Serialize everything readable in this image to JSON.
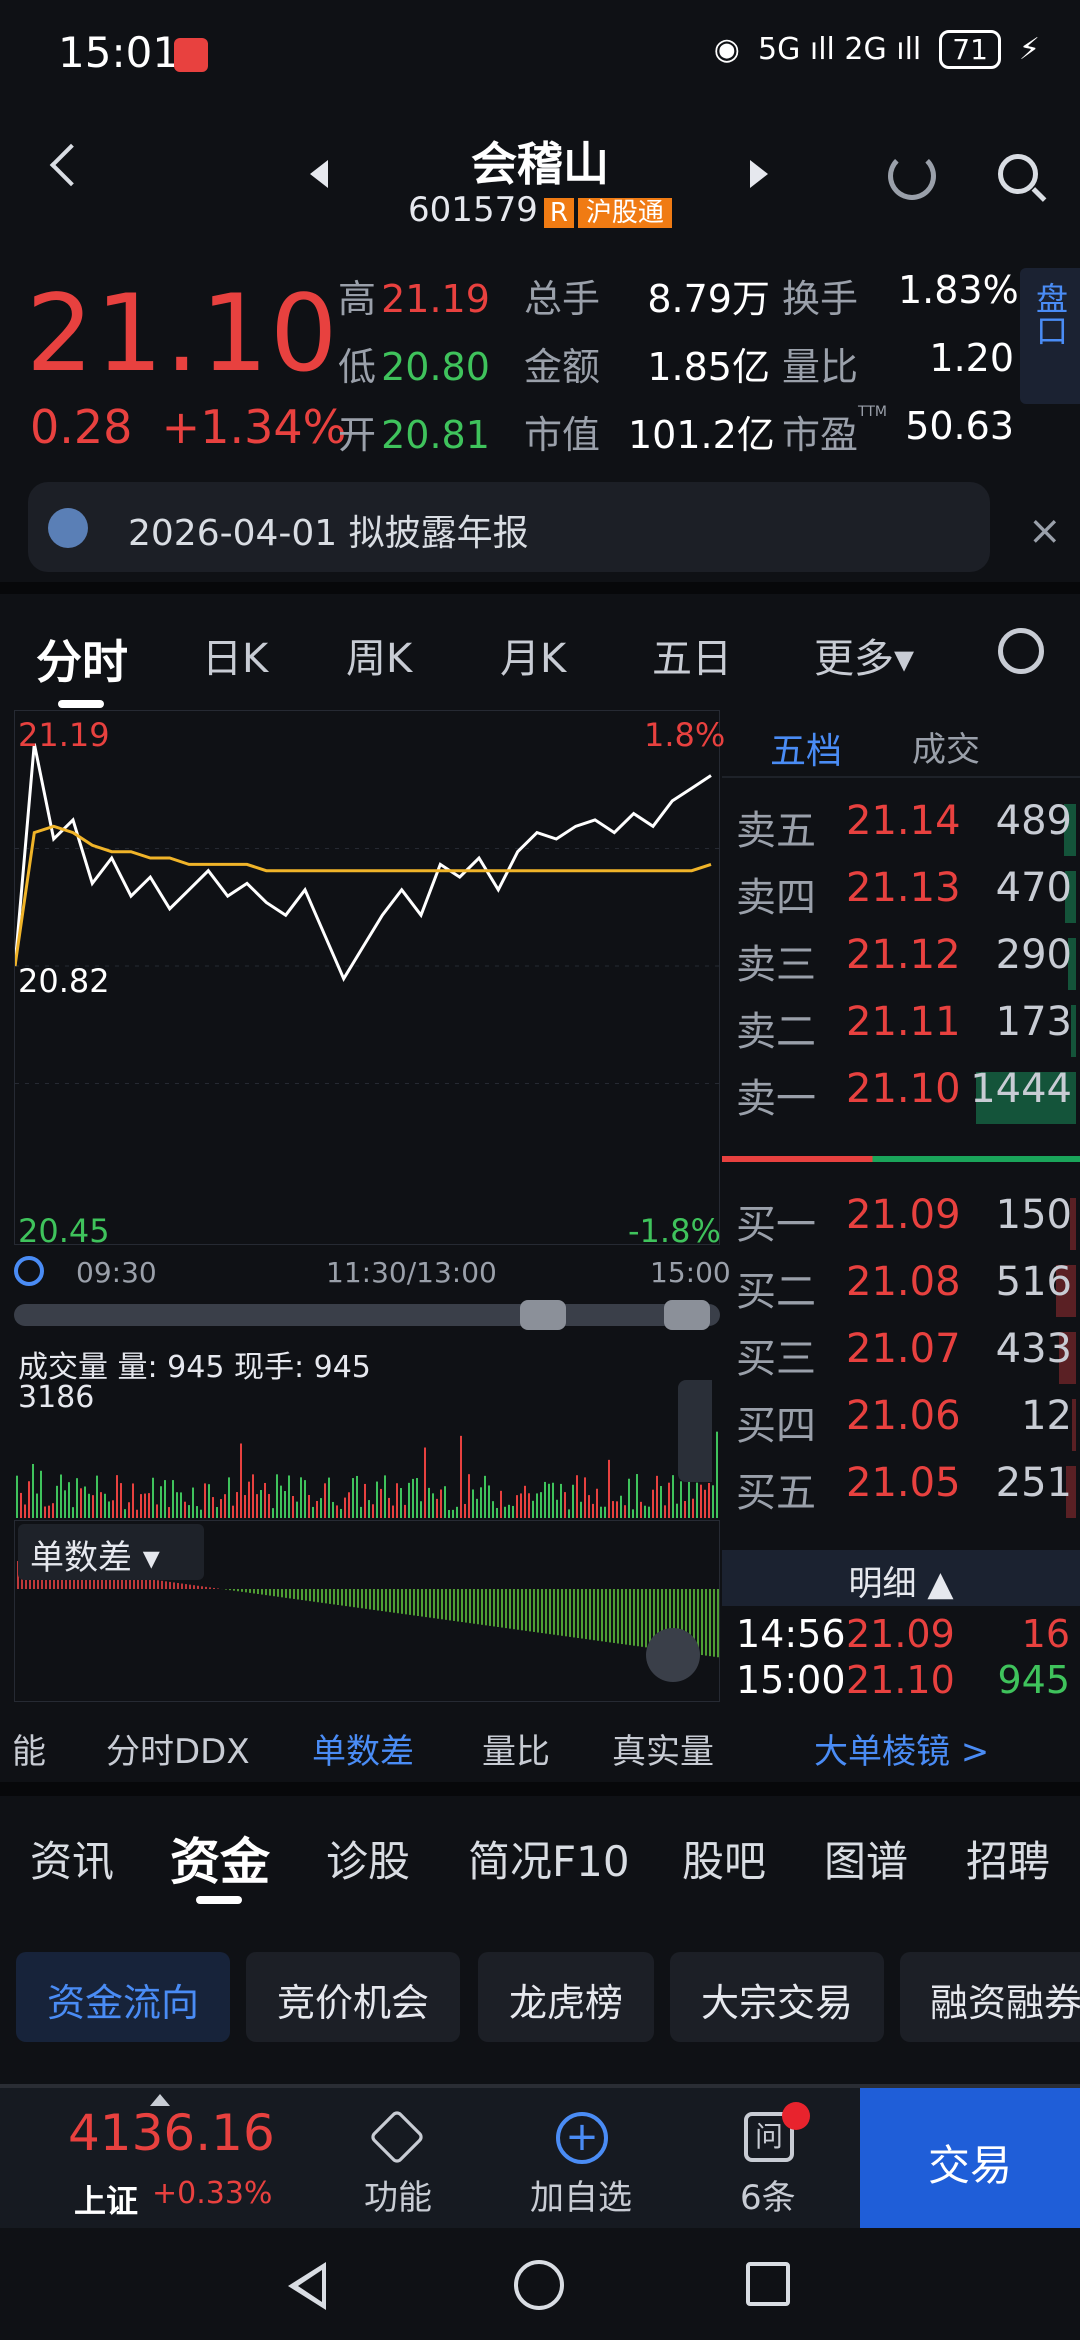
{
  "status_bar": {
    "time": "15:01",
    "network": "5G ıll 2G ıll",
    "battery": "71",
    "wifi_icon": "wifi-icon"
  },
  "header": {
    "stock_name": "会稽山",
    "stock_code": "601579",
    "tag_r": "R",
    "tag_hgt": "沪股通"
  },
  "quote": {
    "price": "21.10",
    "change": "0.28",
    "change_pct": "+1.34%",
    "high_label": "高",
    "high": "21.19",
    "low_label": "低",
    "low": "20.80",
    "open_label": "开",
    "open": "20.81",
    "volume_label": "总手",
    "volume": "8.79万",
    "amount_label": "金额",
    "amount": "1.85亿",
    "mktcap_label": "市值",
    "mktcap": "101.2亿",
    "turnover_label": "换手",
    "turnover": "1.83%",
    "vol_ratio_label": "量比",
    "vol_ratio": "1.20",
    "pe_label": "市盈",
    "pe_sup": "TTM",
    "pe": "50.63",
    "pankou": "盘口"
  },
  "notice": {
    "text": "2026-04-01 拟披露年报",
    "close": "×"
  },
  "chart_tabs": [
    "分时",
    "日K",
    "周K",
    "月K",
    "五日",
    "更多▾"
  ],
  "chart": {
    "price_high": "21.19",
    "price_pre": "20.82",
    "price_low": "20.45",
    "pct_high": "1.8%",
    "pct_low": "-1.8%",
    "time_start": "09:30",
    "time_mid": "11:30/13:00",
    "time_end": "15:00",
    "volume_title": "成交量 量: 945  现手: 945",
    "volume_max": "3186",
    "danshucha_label": "单数差"
  },
  "chart_data": {
    "type": "line",
    "title": "",
    "ylim": [
      20.45,
      21.19
    ],
    "series": [
      {
        "values": [
          20.82,
          21.17,
          21.02,
          21.05,
          20.95,
          20.99,
          20.93,
          20.96,
          20.91,
          20.94,
          20.97,
          20.93,
          20.95,
          20.92,
          20.9,
          20.94,
          20.87,
          20.8,
          20.85,
          20.9,
          20.94,
          20.9,
          20.98,
          20.96,
          20.99,
          20.94,
          21.0,
          21.03,
          21.02,
          21.04,
          21.05,
          21.03,
          21.06,
          21.04,
          21.08,
          21.1,
          21.12
        ]
      },
      {
        "values": [
          20.82,
          21.03,
          21.04,
          21.03,
          21.01,
          21.0,
          21.0,
          20.99,
          20.99,
          20.98,
          20.98,
          20.98,
          20.98,
          20.97,
          20.97,
          20.97,
          20.97,
          20.97,
          20.97,
          20.97,
          20.97,
          20.97,
          20.97,
          20.97,
          20.97,
          20.97,
          20.97,
          20.97,
          20.97,
          20.97,
          20.97,
          20.97,
          20.97,
          20.97,
          20.97,
          20.97,
          20.98
        ]
      }
    ]
  },
  "indicators": [
    "能",
    "分时DDX",
    "单数差",
    "量比",
    "真实量",
    "大单棱镜 >"
  ],
  "order_book": {
    "tab_wudang": "五档",
    "tab_chengjiao": "成交",
    "sell": [
      {
        "label": "卖五",
        "price": "21.14",
        "vol": "489",
        "ratio": 0.12
      },
      {
        "label": "卖四",
        "price": "21.13",
        "vol": "470",
        "ratio": 0.11
      },
      {
        "label": "卖三",
        "price": "21.12",
        "vol": "290",
        "ratio": 0.08
      },
      {
        "label": "卖二",
        "price": "21.11",
        "vol": "173",
        "ratio": 0.05
      },
      {
        "label": "卖一",
        "price": "21.10",
        "vol": "1444",
        "ratio": 1.0
      }
    ],
    "buy": [
      {
        "label": "买一",
        "price": "21.09",
        "vol": "150",
        "ratio": 0.06
      },
      {
        "label": "买二",
        "price": "21.08",
        "vol": "516",
        "ratio": 0.2
      },
      {
        "label": "买三",
        "price": "21.07",
        "vol": "433",
        "ratio": 0.17
      },
      {
        "label": "买四",
        "price": "21.06",
        "vol": "12",
        "ratio": 0.01
      },
      {
        "label": "买五",
        "price": "21.05",
        "vol": "251",
        "ratio": 0.1
      }
    ],
    "detail_title": "明细 ▲",
    "details": [
      {
        "time": "14:56",
        "price": "21.09",
        "vol": "16"
      },
      {
        "time": "15:00",
        "price": "21.10",
        "vol": "945"
      }
    ]
  },
  "info_tabs": [
    "资讯",
    "资金",
    "诊股",
    "简况F10",
    "股吧",
    "图谱",
    "招聘"
  ],
  "sub_tabs": [
    "资金流向",
    "竞价机会",
    "龙虎榜",
    "大宗交易",
    "融资融券"
  ],
  "bottom_bar": {
    "index_value": "4136.16",
    "index_name": "上证",
    "index_change": "+0.33%",
    "func_label": "功能",
    "add_label": "加自选",
    "ask_label": "6条",
    "trade_label": "交易"
  },
  "colors": {
    "up": "#e8413f",
    "down": "#3fc35c",
    "accent": "#4a8cf5",
    "avg_line": "#f0b429"
  }
}
